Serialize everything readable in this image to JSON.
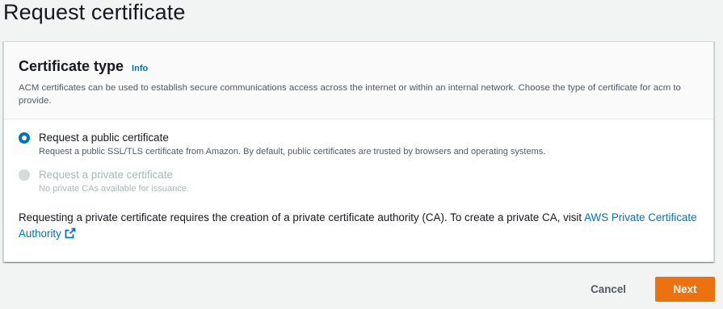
{
  "page": {
    "title": "Request certificate"
  },
  "certificate_type": {
    "title": "Certificate type",
    "info_label": "Info",
    "description": "ACM certificates can be used to establish secure communications access across the internet or within an internal network. Choose the type of certificate for acm to provide.",
    "options": [
      {
        "label": "Request a public certificate",
        "description": "Request a public SSL/TLS certificate from Amazon. By default, public certificates are trusted by browsers and operating systems.",
        "selected": true,
        "disabled": false
      },
      {
        "label": "Request a private certificate",
        "description": "No private CAs available for issuance.",
        "selected": false,
        "disabled": true
      }
    ],
    "note_text": "Requesting a private certificate requires the creation of a private certificate authority (CA). To create a private CA, visit ",
    "note_link": "AWS Private Certificate Authority",
    "note_link_icon": "external-link-icon"
  },
  "footer": {
    "cancel_label": "Cancel",
    "next_label": "Next"
  },
  "colors": {
    "accent": "#0073bb",
    "primary_button": "#ec7211",
    "background": "#f2f3f3"
  }
}
